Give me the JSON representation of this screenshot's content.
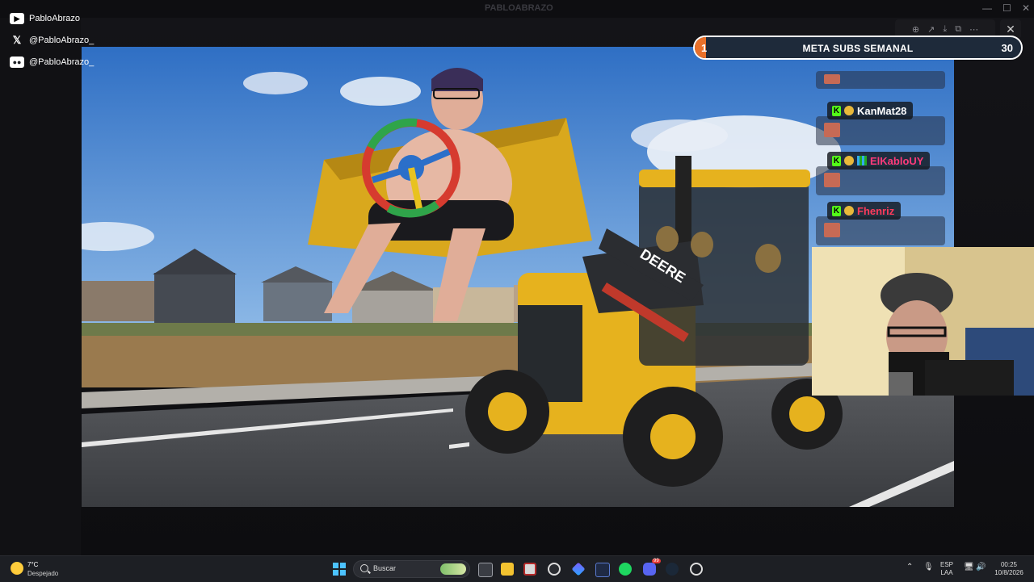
{
  "window": {
    "title": "PABLOABRAZO"
  },
  "socials": [
    {
      "network": "youtube-icon",
      "handle": "PabloAbrazo"
    },
    {
      "network": "x-icon",
      "handle": "@PabloAbrazo_"
    },
    {
      "network": "discord-icon",
      "handle": "@PabloAbrazo_"
    }
  ],
  "sub_goal": {
    "title": "META SUBS SEMANAL",
    "current": "1",
    "goal": "30",
    "progress": 0.033
  },
  "chat": [
    {
      "username": "KanMat28",
      "color": "#ffffff",
      "badges": [
        "k",
        "face"
      ]
    },
    {
      "username": "ElKabloUY",
      "color": "#ff3b7a",
      "badges": [
        "k",
        "face",
        "grid"
      ]
    },
    {
      "username": "Fhenriz",
      "color": "#ff3b5c",
      "badges": [
        "k",
        "face"
      ]
    }
  ],
  "scene": {
    "vehicle_brand": "DEERE"
  },
  "taskbar": {
    "weather_temp": "7°C",
    "weather_desc": "Despejado",
    "search_placeholder": "Buscar",
    "language": "ESP",
    "layout": "LAA",
    "time": "00:25",
    "date": "10/8/2026",
    "discord_badge": "99"
  }
}
